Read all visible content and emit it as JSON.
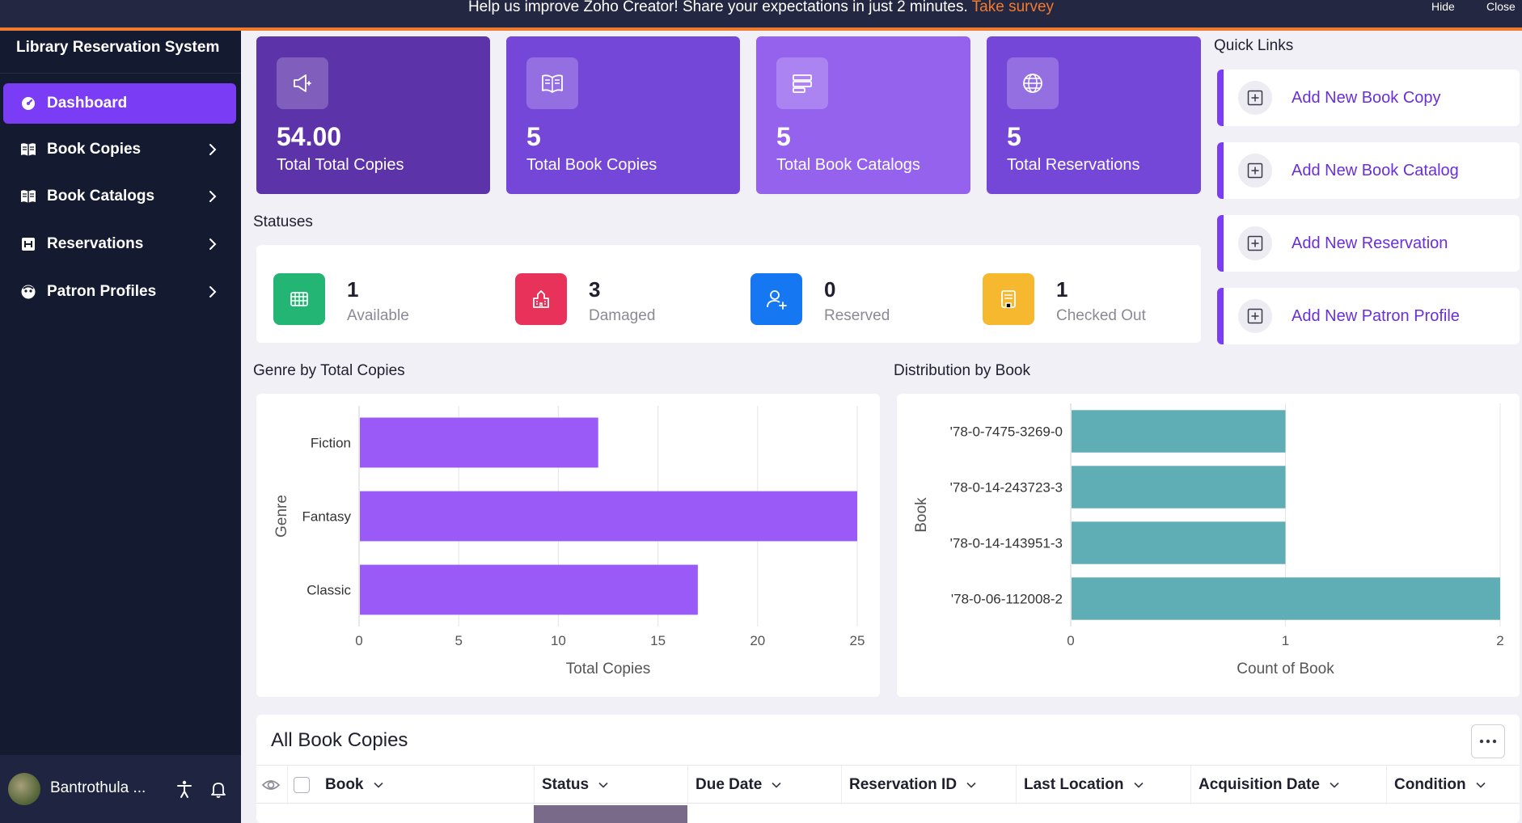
{
  "banner": {
    "message": "Help us improve Zoho Creator! Share your expectations in just 2 minutes.",
    "link": "Take survey",
    "hide_label": "Hide",
    "close_label": "Close"
  },
  "sidebar": {
    "app_title": "Library Reservation System",
    "items": [
      {
        "label": "Dashboard",
        "icon": "dashboard-icon",
        "active": true
      },
      {
        "label": "Book Copies",
        "icon": "book-icon"
      },
      {
        "label": "Book Catalogs",
        "icon": "book-icon"
      },
      {
        "label": "Reservations",
        "icon": "calendar-icon"
      },
      {
        "label": "Patron Profiles",
        "icon": "profile-icon"
      }
    ],
    "user_name": "Bantrothula ..."
  },
  "stats": [
    {
      "value": "54.00",
      "label": "Total Total Copies",
      "icon": "megaphone-icon",
      "color": "#5c33a8"
    },
    {
      "value": "5",
      "label": "Total Book Copies",
      "icon": "book-open-icon",
      "color": "#7547d9"
    },
    {
      "value": "5",
      "label": "Total Book Catalogs",
      "icon": "catalog-icon",
      "color": "#9562ee"
    },
    {
      "value": "5",
      "label": "Total Reservations",
      "icon": "globe-icon",
      "color": "#7547d9"
    }
  ],
  "quick_links": {
    "title": "Quick Links",
    "items": [
      {
        "label": "Add New Book Copy",
        "icon": "plus-square-icon"
      },
      {
        "label": "Add New Book Catalog",
        "icon": "plus-square-icon"
      },
      {
        "label": "Add New Reservation",
        "icon": "plus-square-icon"
      },
      {
        "label": "Add New Patron Profile",
        "icon": "plus-square-icon"
      }
    ]
  },
  "statuses": {
    "title": "Statuses",
    "items": [
      {
        "value": "1",
        "label": "Available",
        "color": "#22b573",
        "icon": "grid-icon"
      },
      {
        "value": "3",
        "label": "Damaged",
        "color": "#e8325a",
        "icon": "building-icon"
      },
      {
        "value": "0",
        "label": "Reserved",
        "color": "#1677f2",
        "icon": "user-add-icon"
      },
      {
        "value": "1",
        "label": "Checked Out",
        "color": "#f5b82e",
        "icon": "archive-icon"
      }
    ]
  },
  "chart_titles": {
    "genre": "Genre by Total Copies",
    "distribution": "Distribution by Book"
  },
  "chart_data": [
    {
      "type": "bar",
      "orientation": "horizontal",
      "categories": [
        "Fiction",
        "Fantasy",
        "Classic"
      ],
      "values": [
        12,
        25,
        17
      ],
      "xlabel": "Total Copies",
      "ylabel": "Genre",
      "xlim": [
        0,
        25
      ],
      "xticks": [
        "0",
        "5",
        "10",
        "15",
        "20",
        "25"
      ],
      "color": "#9a5af7",
      "grid": true
    },
    {
      "type": "bar",
      "orientation": "horizontal",
      "categories": [
        "'78-0-7475-3269-0",
        "'78-0-14-243723-3",
        "'78-0-14-143951-3",
        "'78-0-06-112008-2"
      ],
      "values": [
        1,
        1,
        1,
        2
      ],
      "xlabel": "Count of Book",
      "ylabel": "Book",
      "xlim": [
        0,
        2
      ],
      "xticks": [
        "0",
        "1",
        "2"
      ],
      "color": "#5fadb5",
      "grid": true
    }
  ],
  "table": {
    "title": "All Book Copies",
    "columns": [
      "Book",
      "Status",
      "Due Date",
      "Reservation ID",
      "Last Location",
      "Acquisition Date",
      "Condition"
    ]
  }
}
